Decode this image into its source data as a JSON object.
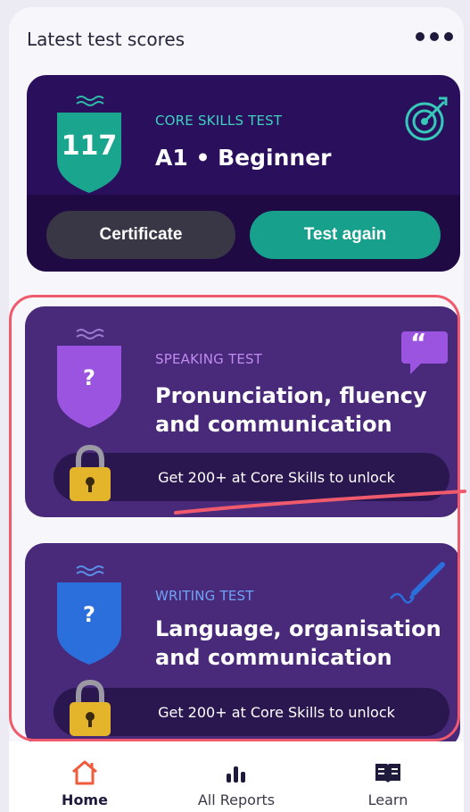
{
  "header": {
    "title": "Latest test scores"
  },
  "core": {
    "score": "117",
    "label": "CORE SKILLS TEST",
    "level": "A1 • Beginner",
    "certificate_label": "Certificate",
    "test_again_label": "Test again"
  },
  "speaking": {
    "badge": "?",
    "label": "SPEAKING TEST",
    "title_line1": "Pronunciation, fluency",
    "title_line2": "and communication",
    "unlock_text": "Get 200+ at Core Skills to unlock",
    "quote_glyph": "“"
  },
  "writing": {
    "badge": "?",
    "label": "WRITING TEST",
    "title_line1": "Language, organisation",
    "title_line2": "and communication",
    "unlock_text": "Get 200+ at Core Skills to unlock"
  },
  "tabs": [
    {
      "label": "Home",
      "icon": "home-icon"
    },
    {
      "label": "All Reports",
      "icon": "bar-chart-icon"
    },
    {
      "label": "Learn",
      "icon": "book-icon"
    }
  ],
  "colors": {
    "teal": "#17a08c",
    "core_bg": "#2a0f5c",
    "card_bg": "#48297a",
    "highlight": "#ef5b6c",
    "speaking_purple": "#9b54e0",
    "writing_blue": "#2a6fdc"
  }
}
